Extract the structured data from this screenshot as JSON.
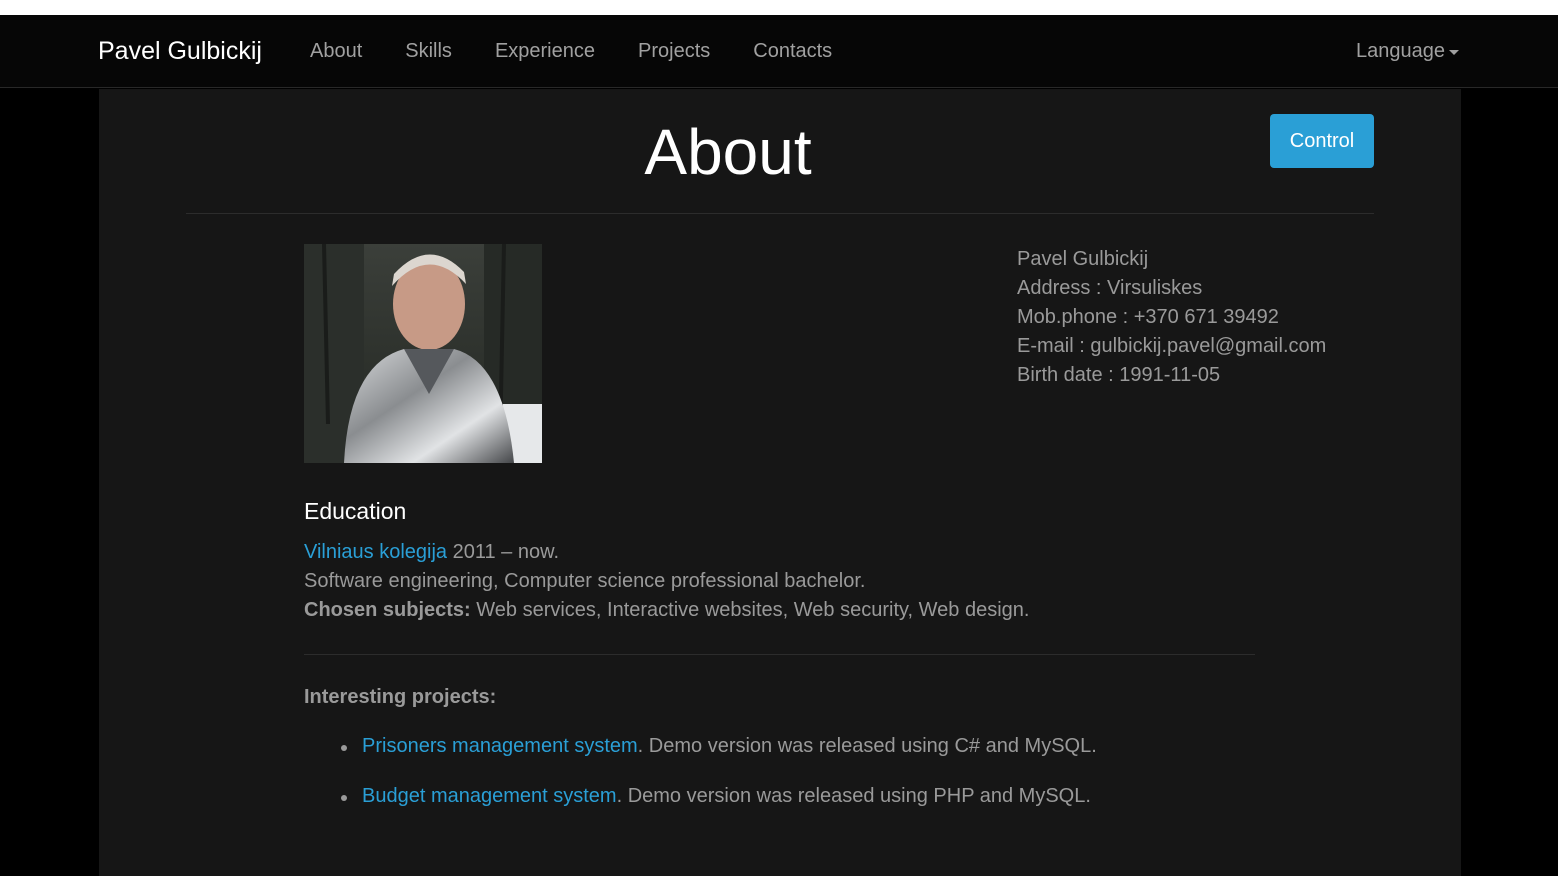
{
  "navbar": {
    "brand": "Pavel Gulbickij",
    "links": [
      "About",
      "Skills",
      "Experience",
      "Projects",
      "Contacts"
    ],
    "language_label": "Language"
  },
  "page": {
    "title": "About",
    "control_label": "Control"
  },
  "profile": {
    "name": "Pavel Gulbickij",
    "address": "Address : Virsuliskes",
    "phone": "Mob.phone : +370 671 39492",
    "email": "E-mail : gulbickij.pavel@gmail.com",
    "birth": "Birth date : 1991-11-05"
  },
  "education": {
    "heading": "Education",
    "school_link": "Vilniaus kolegija",
    "years": " 2011 – now.",
    "degree": "Software engineering, Computer science professional bachelor.",
    "subjects_label": "Chosen subjects:",
    "subjects": " Web services, Interactive websites, Web security, Web design."
  },
  "projects": {
    "heading": "Interesting projects:",
    "items": [
      {
        "link": "Prisoners management system",
        "desc": ". Demo version was released using C# and MySQL."
      },
      {
        "link": "Budget management system",
        "desc": ". Demo version was released using PHP and MySQL."
      }
    ]
  },
  "colors": {
    "accent": "#2a9fd6",
    "background": "#161616",
    "navbar": "#060606"
  }
}
